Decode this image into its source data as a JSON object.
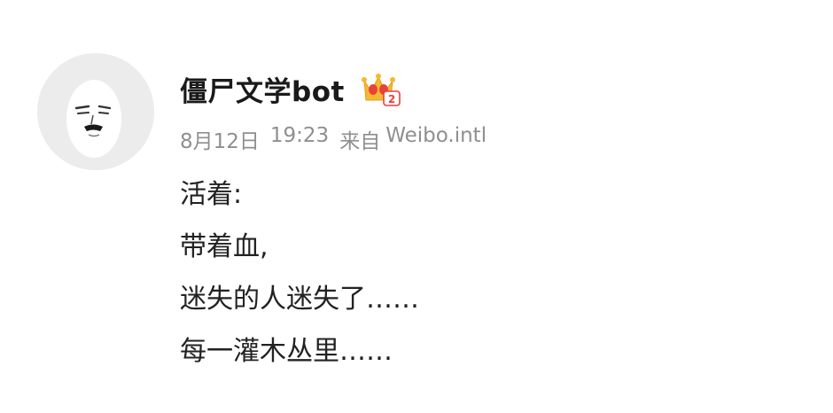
{
  "post": {
    "username": "僵尸文学bot",
    "badge_icon": "vip-crown-icon",
    "meta": {
      "date": "8月12日",
      "time": "19:23",
      "source_prefix": "来自",
      "source": "Weibo.intl"
    },
    "lines": [
      "活着:",
      "带着血,",
      "迷失的人迷失了……",
      "每一灌木丛里……"
    ]
  },
  "colors": {
    "avatar_bg": "#ececec",
    "meta_text": "#8f8f8f",
    "body_text": "#222222",
    "crown_gold": "#f5b82e",
    "badge_red": "#e8413d"
  }
}
